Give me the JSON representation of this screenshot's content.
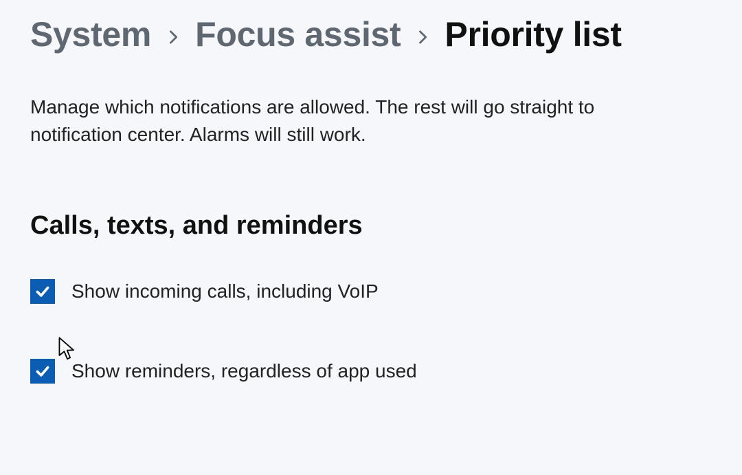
{
  "breadcrumb": {
    "items": [
      {
        "label": "System",
        "current": false
      },
      {
        "label": "Focus assist",
        "current": false
      },
      {
        "label": "Priority list",
        "current": true
      }
    ]
  },
  "description": "Manage which notifications are allowed. The rest will go straight to notification center. Alarms will still work.",
  "section": {
    "heading": "Calls, texts, and reminders",
    "options": [
      {
        "label": "Show incoming calls, including VoIP",
        "checked": true
      },
      {
        "label": "Show reminders, regardless of app used",
        "checked": true
      }
    ]
  },
  "colors": {
    "accent": "#0a5db3",
    "background": "#f5f7fb",
    "text_muted": "#5f6770",
    "text": "#111"
  }
}
